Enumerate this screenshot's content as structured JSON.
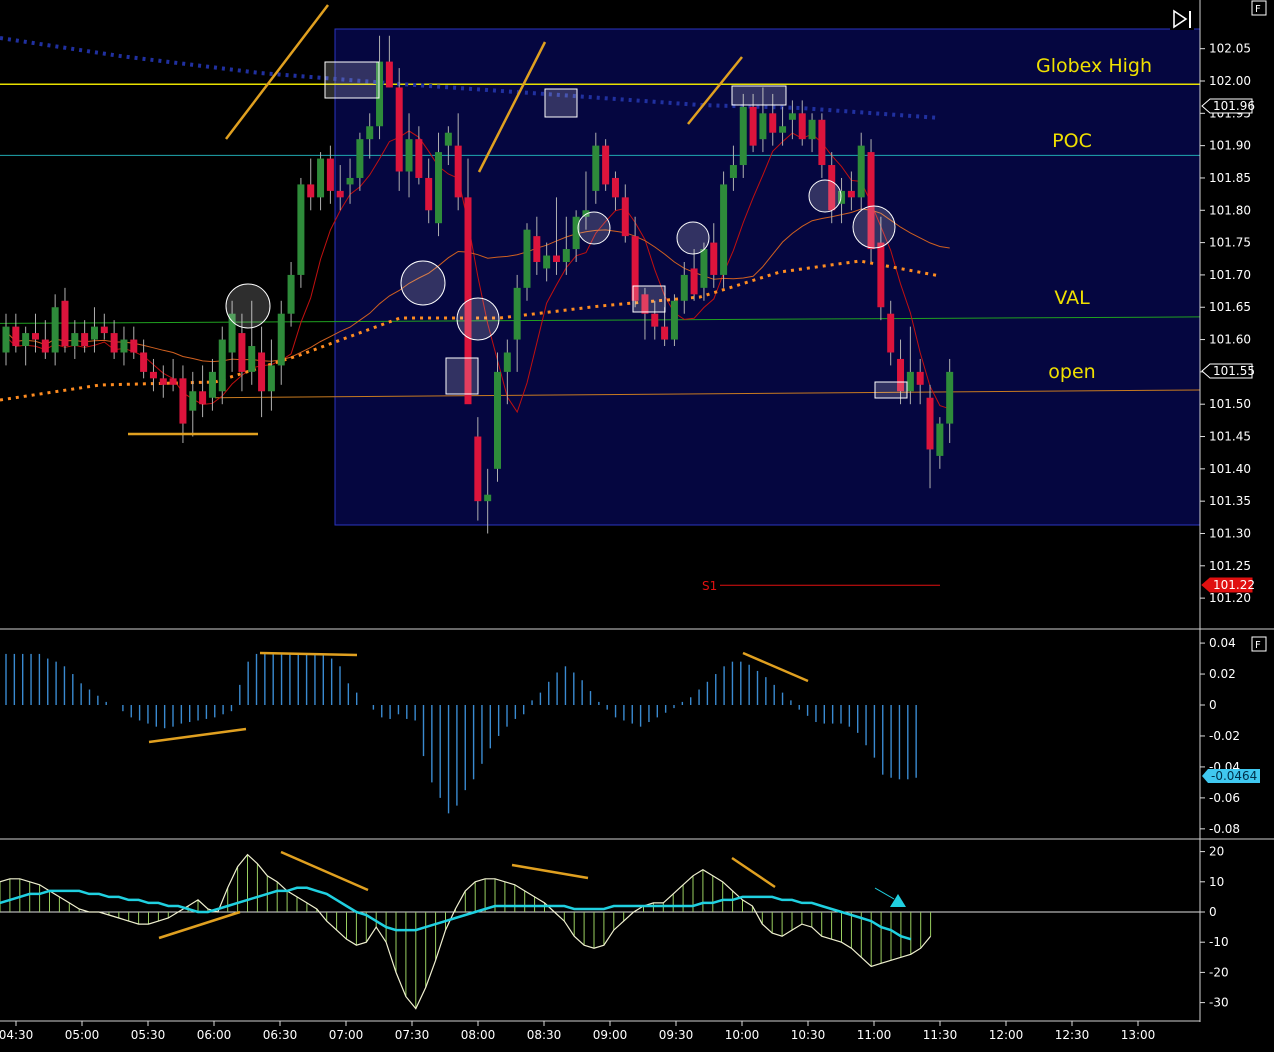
{
  "toolbar": {
    "end_icon": "skip-to-end-icon",
    "panel_button_label": "F"
  },
  "colors": {
    "background": "#000000",
    "session_box_fill": "#050640",
    "session_box_stroke": "#2a35c0",
    "bull": "#2e8b3a",
    "bear": "#dc143c",
    "globex_high": "#e8e000",
    "poc": "#20a8b0",
    "val": "#20a020",
    "open": "#c87a20",
    "annotation": "#e0a020",
    "vwap": "#ff8c20",
    "dotted_ma": "#2030a0",
    "thin_ma": "#c01010",
    "orange_ma": "#d06020",
    "histogram": "#3a8ad0",
    "osc_fill": "#9ad060",
    "signal": "#20d0e0",
    "axis_text": "#ffffff",
    "s1": "#e01010"
  },
  "chart_data": [
    {
      "type": "candlestick",
      "panel": "price",
      "x_ticks": [
        "04:30",
        "05:00",
        "05:30",
        "06:00",
        "06:30",
        "07:00",
        "07:30",
        "08:00",
        "08:30",
        "09:00",
        "09:30",
        "10:00",
        "10:30",
        "11:00",
        "11:30",
        "12:00",
        "12:30",
        "13:00"
      ],
      "y_ticks": [
        "102.05",
        "102.00",
        "101.95",
        "101.90",
        "101.85",
        "101.80",
        "101.75",
        "101.70",
        "101.65",
        "101.60",
        "101.55",
        "101.50",
        "101.45",
        "101.40",
        "101.35",
        "101.30",
        "101.25",
        "101.20"
      ],
      "ylim": [
        101.18,
        102.1
      ],
      "candles": [
        {
          "o": 101.58,
          "h": 101.64,
          "l": 101.56,
          "c": 101.62
        },
        {
          "o": 101.62,
          "h": 101.64,
          "l": 101.58,
          "c": 101.59
        },
        {
          "o": 101.59,
          "h": 101.62,
          "l": 101.56,
          "c": 101.61
        },
        {
          "o": 101.61,
          "h": 101.64,
          "l": 101.58,
          "c": 101.6
        },
        {
          "o": 101.6,
          "h": 101.63,
          "l": 101.57,
          "c": 101.58
        },
        {
          "o": 101.58,
          "h": 101.67,
          "l": 101.56,
          "c": 101.65
        },
        {
          "o": 101.66,
          "h": 101.68,
          "l": 101.58,
          "c": 101.59
        },
        {
          "o": 101.59,
          "h": 101.63,
          "l": 101.57,
          "c": 101.61
        },
        {
          "o": 101.61,
          "h": 101.63,
          "l": 101.58,
          "c": 101.59
        },
        {
          "o": 101.6,
          "h": 101.65,
          "l": 101.58,
          "c": 101.62
        },
        {
          "o": 101.62,
          "h": 101.64,
          "l": 101.6,
          "c": 101.61
        },
        {
          "o": 101.61,
          "h": 101.63,
          "l": 101.57,
          "c": 101.58
        },
        {
          "o": 101.58,
          "h": 101.62,
          "l": 101.56,
          "c": 101.6
        },
        {
          "o": 101.6,
          "h": 101.62,
          "l": 101.57,
          "c": 101.58
        },
        {
          "o": 101.58,
          "h": 101.6,
          "l": 101.54,
          "c": 101.55
        },
        {
          "o": 101.55,
          "h": 101.57,
          "l": 101.52,
          "c": 101.54
        },
        {
          "o": 101.54,
          "h": 101.56,
          "l": 101.51,
          "c": 101.53
        },
        {
          "o": 101.54,
          "h": 101.57,
          "l": 101.52,
          "c": 101.53
        },
        {
          "o": 101.54,
          "h": 101.56,
          "l": 101.44,
          "c": 101.47
        },
        {
          "o": 101.49,
          "h": 101.55,
          "l": 101.45,
          "c": 101.52
        },
        {
          "o": 101.52,
          "h": 101.56,
          "l": 101.48,
          "c": 101.5
        },
        {
          "o": 101.51,
          "h": 101.57,
          "l": 101.49,
          "c": 101.55
        },
        {
          "o": 101.52,
          "h": 101.62,
          "l": 101.5,
          "c": 101.6
        },
        {
          "o": 101.58,
          "h": 101.66,
          "l": 101.55,
          "c": 101.64
        },
        {
          "o": 101.61,
          "h": 101.64,
          "l": 101.52,
          "c": 101.55
        },
        {
          "o": 101.55,
          "h": 101.66,
          "l": 101.53,
          "c": 101.59
        },
        {
          "o": 101.58,
          "h": 101.62,
          "l": 101.48,
          "c": 101.52
        },
        {
          "o": 101.52,
          "h": 101.6,
          "l": 101.49,
          "c": 101.56
        },
        {
          "o": 101.56,
          "h": 101.66,
          "l": 101.53,
          "c": 101.64
        },
        {
          "o": 101.64,
          "h": 101.72,
          "l": 101.62,
          "c": 101.7
        },
        {
          "o": 101.7,
          "h": 101.85,
          "l": 101.68,
          "c": 101.84
        },
        {
          "o": 101.84,
          "h": 101.88,
          "l": 101.8,
          "c": 101.82
        },
        {
          "o": 101.82,
          "h": 101.89,
          "l": 101.8,
          "c": 101.88
        },
        {
          "o": 101.88,
          "h": 101.9,
          "l": 101.81,
          "c": 101.83
        },
        {
          "o": 101.83,
          "h": 101.87,
          "l": 101.8,
          "c": 101.82
        },
        {
          "o": 101.84,
          "h": 101.88,
          "l": 101.81,
          "c": 101.85
        },
        {
          "o": 101.85,
          "h": 101.92,
          "l": 101.83,
          "c": 101.91
        },
        {
          "o": 101.91,
          "h": 101.95,
          "l": 101.88,
          "c": 101.93
        },
        {
          "o": 101.93,
          "h": 102.07,
          "l": 101.91,
          "c": 102.03
        },
        {
          "o": 102.03,
          "h": 102.07,
          "l": 101.99,
          "c": 101.99
        },
        {
          "o": 101.99,
          "h": 102.02,
          "l": 101.83,
          "c": 101.86
        },
        {
          "o": 101.86,
          "h": 101.95,
          "l": 101.82,
          "c": 101.91
        },
        {
          "o": 101.91,
          "h": 101.93,
          "l": 101.84,
          "c": 101.85
        },
        {
          "o": 101.85,
          "h": 101.88,
          "l": 101.78,
          "c": 101.8
        },
        {
          "o": 101.78,
          "h": 101.92,
          "l": 101.76,
          "c": 101.89
        },
        {
          "o": 101.9,
          "h": 101.93,
          "l": 101.87,
          "c": 101.92
        },
        {
          "o": 101.9,
          "h": 101.95,
          "l": 101.8,
          "c": 101.82
        },
        {
          "o": 101.82,
          "h": 101.88,
          "l": 101.75,
          "c": 101.5
        },
        {
          "o": 101.45,
          "h": 101.48,
          "l": 101.32,
          "c": 101.35
        },
        {
          "o": 101.35,
          "h": 101.4,
          "l": 101.3,
          "c": 101.36
        },
        {
          "o": 101.4,
          "h": 101.58,
          "l": 101.38,
          "c": 101.55
        },
        {
          "o": 101.55,
          "h": 101.6,
          "l": 101.5,
          "c": 101.58
        },
        {
          "o": 101.6,
          "h": 101.7,
          "l": 101.55,
          "c": 101.68
        },
        {
          "o": 101.68,
          "h": 101.78,
          "l": 101.66,
          "c": 101.77
        },
        {
          "o": 101.76,
          "h": 101.79,
          "l": 101.7,
          "c": 101.72
        },
        {
          "o": 101.71,
          "h": 101.75,
          "l": 101.69,
          "c": 101.73
        },
        {
          "o": 101.73,
          "h": 101.82,
          "l": 101.7,
          "c": 101.72
        },
        {
          "o": 101.72,
          "h": 101.79,
          "l": 101.7,
          "c": 101.74
        },
        {
          "o": 101.74,
          "h": 101.8,
          "l": 101.72,
          "c": 101.79
        },
        {
          "o": 101.79,
          "h": 101.86,
          "l": 101.77,
          "c": 101.8
        },
        {
          "o": 101.83,
          "h": 101.92,
          "l": 101.81,
          "c": 101.9
        },
        {
          "o": 101.9,
          "h": 101.91,
          "l": 101.83,
          "c": 101.84
        },
        {
          "o": 101.85,
          "h": 101.86,
          "l": 101.8,
          "c": 101.82
        },
        {
          "o": 101.82,
          "h": 101.84,
          "l": 101.75,
          "c": 101.76
        },
        {
          "o": 101.76,
          "h": 101.79,
          "l": 101.65,
          "c": 101.66
        },
        {
          "o": 101.67,
          "h": 101.68,
          "l": 101.6,
          "c": 101.64
        },
        {
          "o": 101.64,
          "h": 101.66,
          "l": 101.6,
          "c": 101.62
        },
        {
          "o": 101.62,
          "h": 101.65,
          "l": 101.59,
          "c": 101.6
        },
        {
          "o": 101.6,
          "h": 101.67,
          "l": 101.59,
          "c": 101.66
        },
        {
          "o": 101.66,
          "h": 101.72,
          "l": 101.64,
          "c": 101.7
        },
        {
          "o": 101.71,
          "h": 101.74,
          "l": 101.66,
          "c": 101.67
        },
        {
          "o": 101.68,
          "h": 101.75,
          "l": 101.66,
          "c": 101.74
        },
        {
          "o": 101.75,
          "h": 101.78,
          "l": 101.68,
          "c": 101.7
        },
        {
          "o": 101.7,
          "h": 101.86,
          "l": 101.68,
          "c": 101.84
        },
        {
          "o": 101.85,
          "h": 101.9,
          "l": 101.83,
          "c": 101.87
        },
        {
          "o": 101.87,
          "h": 101.98,
          "l": 101.85,
          "c": 101.96
        },
        {
          "o": 101.96,
          "h": 101.98,
          "l": 101.89,
          "c": 101.9
        },
        {
          "o": 101.91,
          "h": 101.99,
          "l": 101.89,
          "c": 101.95
        },
        {
          "o": 101.95,
          "h": 101.98,
          "l": 101.9,
          "c": 101.92
        },
        {
          "o": 101.92,
          "h": 101.96,
          "l": 101.9,
          "c": 101.93
        },
        {
          "o": 101.94,
          "h": 101.97,
          "l": 101.91,
          "c": 101.95
        },
        {
          "o": 101.95,
          "h": 101.97,
          "l": 101.9,
          "c": 101.91
        },
        {
          "o": 101.91,
          "h": 101.95,
          "l": 101.89,
          "c": 101.94
        },
        {
          "o": 101.94,
          "h": 101.95,
          "l": 101.85,
          "c": 101.87
        },
        {
          "o": 101.87,
          "h": 101.89,
          "l": 101.78,
          "c": 101.8
        },
        {
          "o": 101.81,
          "h": 101.85,
          "l": 101.78,
          "c": 101.83
        },
        {
          "o": 101.83,
          "h": 101.86,
          "l": 101.8,
          "c": 101.82
        },
        {
          "o": 101.82,
          "h": 101.92,
          "l": 101.8,
          "c": 101.9
        },
        {
          "o": 101.89,
          "h": 101.91,
          "l": 101.72,
          "c": 101.74
        },
        {
          "o": 101.75,
          "h": 101.79,
          "l": 101.63,
          "c": 101.65
        },
        {
          "o": 101.64,
          "h": 101.66,
          "l": 101.56,
          "c": 101.58
        },
        {
          "o": 101.57,
          "h": 101.6,
          "l": 101.5,
          "c": 101.52
        },
        {
          "o": 101.52,
          "h": 101.62,
          "l": 101.5,
          "c": 101.55
        },
        {
          "o": 101.55,
          "h": 101.57,
          "l": 101.5,
          "c": 101.53
        },
        {
          "o": 101.51,
          "h": 101.53,
          "l": 101.37,
          "c": 101.43
        },
        {
          "o": 101.42,
          "h": 101.48,
          "l": 101.4,
          "c": 101.47
        },
        {
          "o": 101.47,
          "h": 101.57,
          "l": 101.44,
          "c": 101.55
        }
      ],
      "levels": [
        {
          "label": "Globex High",
          "value": 101.995
        },
        {
          "label": "POC",
          "value": 101.885
        },
        {
          "label": "VAL",
          "value": 101.633
        },
        {
          "label": "open",
          "value": 101.52
        }
      ],
      "s1": {
        "label": "S1",
        "value": 101.22
      },
      "price_tags": [
        {
          "value": 101.96,
          "text": "101.96",
          "style": "white"
        },
        {
          "value": 101.55,
          "text": "101.55",
          "style": "white"
        },
        {
          "value": 101.22,
          "text": "101.22",
          "style": "red"
        }
      ]
    },
    {
      "type": "bar",
      "panel": "histogram",
      "y_ticks": [
        "0.04",
        "0.02",
        "0",
        "-0.02",
        "-0.04",
        "-0.06",
        "-0.08"
      ],
      "ylim": [
        -0.085,
        0.045
      ],
      "last_value_label": "-0.0464",
      "values": [
        0.033,
        0.033,
        0.033,
        0.033,
        0.033,
        0.03,
        0.028,
        0.025,
        0.02,
        0.014,
        0.01,
        0.006,
        0.002,
        0,
        -0.004,
        -0.008,
        -0.01,
        -0.012,
        -0.014,
        -0.015,
        -0.014,
        -0.012,
        -0.011,
        -0.01,
        -0.009,
        -0.008,
        -0.006,
        -0.004,
        0.013,
        0.028,
        0.033,
        0.033,
        0.033,
        0.033,
        0.033,
        0.033,
        0.033,
        0.033,
        0.033,
        0.03,
        0.025,
        0.014,
        0.008,
        0,
        -0.003,
        -0.008,
        -0.009,
        -0.006,
        -0.009,
        -0.01,
        -0.033,
        -0.05,
        -0.06,
        -0.07,
        -0.065,
        -0.055,
        -0.048,
        -0.038,
        -0.028,
        -0.02,
        -0.014,
        -0.009,
        -0.006,
        0.003,
        0.008,
        0.015,
        0.021,
        0.025,
        0.021,
        0.016,
        0.009,
        0.002,
        -0.003,
        -0.008,
        -0.01,
        -0.012,
        -0.014,
        -0.011,
        -0.008,
        -0.005,
        -0.002,
        0.002,
        0.005,
        0.01,
        0.015,
        0.02,
        0.025,
        0.028,
        0.028,
        0.026,
        0.022,
        0.018,
        0.013,
        0.008,
        0.003,
        -0.003,
        -0.007,
        -0.011,
        -0.012,
        -0.012,
        -0.012,
        -0.014,
        -0.018,
        -0.026,
        -0.034,
        -0.045,
        -0.047,
        -0.048,
        -0.048,
        -0.047
      ]
    },
    {
      "type": "area",
      "panel": "oscillator",
      "y_ticks": [
        "20",
        "10",
        "0",
        "-10",
        "-20",
        "-30"
      ],
      "ylim": [
        -35,
        22
      ],
      "series": [
        {
          "kind": "filled_line",
          "values": [
            10,
            11,
            11,
            10,
            9,
            7,
            5,
            3,
            1,
            0,
            0,
            -1,
            -2,
            -3,
            -4,
            -4,
            -3,
            -2,
            0,
            2,
            4,
            1,
            0,
            8,
            15,
            19,
            16,
            12,
            10,
            7,
            5,
            3,
            1,
            -3,
            -6,
            -9,
            -11,
            -10,
            -5,
            -10,
            -20,
            -28,
            -32,
            -25,
            -16,
            -6,
            1,
            7,
            10,
            11,
            11,
            10,
            9,
            7,
            5,
            3,
            0,
            -3,
            -8,
            -11,
            -12,
            -11,
            -6,
            -3,
            0,
            2,
            3,
            3,
            6,
            9,
            12,
            14,
            12,
            10,
            7,
            4,
            2,
            -4,
            -7,
            -8,
            -6,
            -4,
            -5,
            -8,
            -9,
            -10,
            -12,
            -15,
            -18,
            -17,
            -16,
            -15,
            -14,
            -12,
            -8
          ]
        },
        {
          "kind": "signal_line",
          "values": [
            3,
            4,
            5,
            6,
            6,
            7,
            7,
            7,
            7,
            6,
            6,
            5,
            5,
            4,
            4,
            3,
            3,
            2,
            2,
            1,
            0,
            0,
            1,
            2,
            3,
            4,
            5,
            6,
            7,
            7,
            8,
            8,
            7,
            6,
            4,
            2,
            0,
            -1,
            -3,
            -5,
            -6,
            -6,
            -6,
            -5,
            -4,
            -3,
            -2,
            -1,
            0,
            1,
            2,
            2,
            2,
            2,
            2,
            2,
            2,
            2,
            1,
            1,
            1,
            1,
            2,
            2,
            2,
            2,
            2,
            2,
            2,
            2,
            2,
            3,
            3,
            4,
            4,
            5,
            5,
            5,
            5,
            4,
            4,
            3,
            3,
            2,
            1,
            0,
            -1,
            -2,
            -3,
            -5,
            -6,
            -8,
            -9
          ]
        }
      ]
    }
  ]
}
